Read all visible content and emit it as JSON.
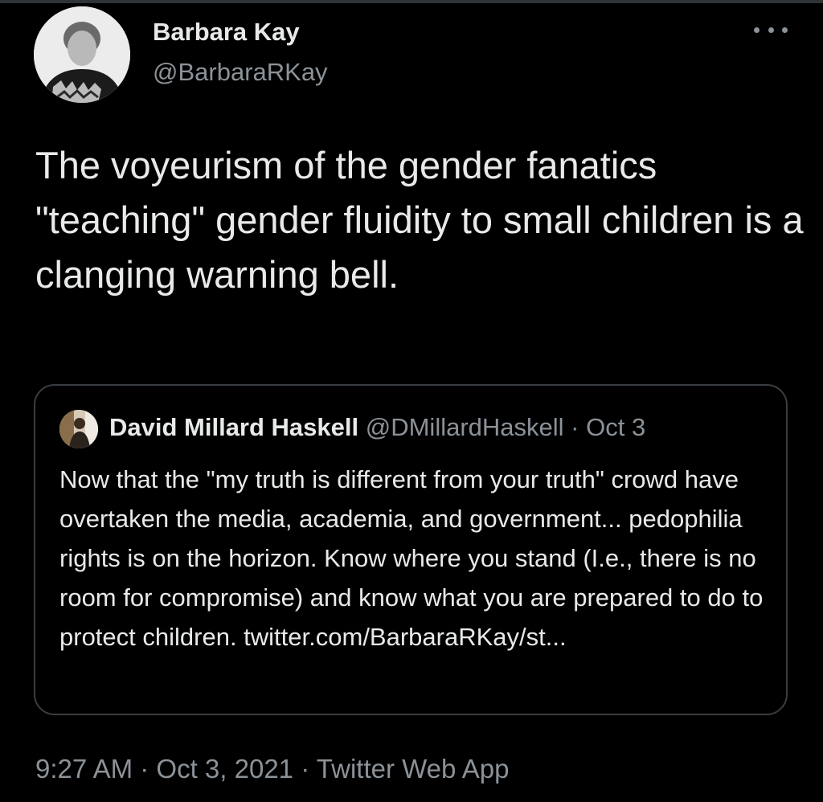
{
  "tweet": {
    "author": {
      "display_name": "Barbara Kay",
      "handle": "@BarbaraRKay",
      "avatar_icon": "profile-photo"
    },
    "more_icon": "more-horizontal-icon",
    "text": "The voyeurism of the gender fanatics \"teaching\" gender fluidity to small children is a clanging warning bell.",
    "quoted": {
      "author": {
        "display_name": "David Millard Haskell",
        "handle": "@DMillardHaskell",
        "avatar_icon": "profile-photo"
      },
      "separator": "·",
      "date": "Oct 3",
      "text": "Now that the \"my truth is different from your truth\" crowd have overtaken the media, academia, and government... pedophilia rights is on the horizon. Know where you stand (I.e., there is no room for compromise) and know what you are prepared to do to protect children. twitter.com/BarbaraRKay/st..."
    },
    "meta": {
      "time": "9:27 AM",
      "separator": "·",
      "date": "Oct 3, 2021",
      "source": "Twitter Web App"
    }
  },
  "colors": {
    "background": "#000000",
    "primary_text": "#e7e9ea",
    "secondary_text": "#8b9298",
    "border": "#3a3e42"
  }
}
